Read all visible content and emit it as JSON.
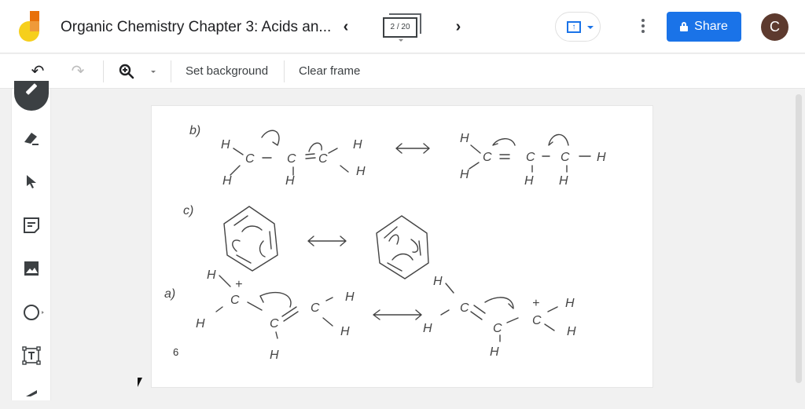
{
  "header": {
    "app_logo": "jamboard-logo",
    "title": "Organic Chemistry Chapter 3: Acids an...",
    "prev_icon": "‹",
    "next_icon": "›",
    "frame_counter": "2 / 20",
    "cast_icon": "↑",
    "share_label": "Share",
    "avatar_initial": "C"
  },
  "colors": {
    "accent": "#1a73e8",
    "avatar_bg": "#5d3a2e",
    "logo_yellow": "#f6cf1c",
    "logo_orange": "#e8710a"
  },
  "toolbar": {
    "undo_icon": "↶",
    "redo_icon": "↷",
    "zoom_icon": "⊕",
    "set_background_label": "Set background",
    "clear_frame_label": "Clear frame"
  },
  "sidebar": {
    "tools": [
      {
        "name": "pen",
        "icon": "pen-icon"
      },
      {
        "name": "eraser",
        "icon": "eraser-icon"
      },
      {
        "name": "select",
        "icon": "cursor-icon"
      },
      {
        "name": "sticky-note",
        "icon": "sticky-note-icon"
      },
      {
        "name": "image",
        "icon": "image-icon"
      },
      {
        "name": "shape",
        "icon": "circle-icon"
      },
      {
        "name": "text-box",
        "icon": "text-box-icon"
      },
      {
        "name": "laser",
        "icon": "laser-icon"
      }
    ]
  },
  "frame": {
    "page_number": "6",
    "handwriting": {
      "b_label": "b)",
      "c_label": "c)",
      "a_label": "a)",
      "atom_H": "H",
      "atom_C": "C",
      "plus": "+"
    }
  }
}
